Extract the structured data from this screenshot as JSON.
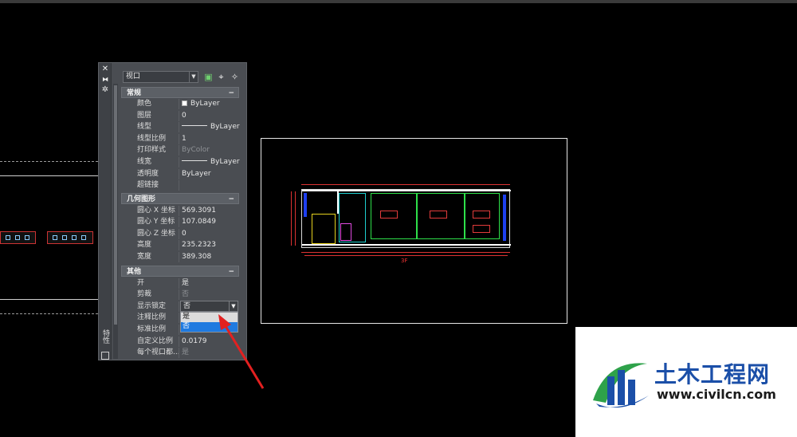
{
  "palette": {
    "vertical_title": "特性",
    "selector_value": "视口",
    "sections": {
      "general": {
        "title": "常规",
        "rows": [
          {
            "key": "颜色",
            "value": "ByLayer"
          },
          {
            "key": "图层",
            "value": "0"
          },
          {
            "key": "线型",
            "value": "ByLayer"
          },
          {
            "key": "线型比例",
            "value": "1"
          },
          {
            "key": "打印样式",
            "value": "ByColor"
          },
          {
            "key": "线宽",
            "value": "ByLayer"
          },
          {
            "key": "透明度",
            "value": "ByLayer"
          },
          {
            "key": "超链接",
            "value": ""
          }
        ]
      },
      "geometry": {
        "title": "几何图形",
        "rows": [
          {
            "key": "圆心 X 坐标",
            "value": "569.3091"
          },
          {
            "key": "圆心 Y 坐标",
            "value": "107.0849"
          },
          {
            "key": "圆心 Z 坐标",
            "value": "0"
          },
          {
            "key": "高度",
            "value": "235.2323"
          },
          {
            "key": "宽度",
            "value": "389.308"
          }
        ]
      },
      "misc": {
        "title": "其他",
        "rows": [
          {
            "key": "开",
            "value": "是"
          },
          {
            "key": "剪裁",
            "value": "否"
          },
          {
            "key": "显示锁定",
            "value": "否"
          },
          {
            "key": "注释比例",
            "value": ""
          },
          {
            "key": "标准比例",
            "value": ""
          },
          {
            "key": "自定义比例",
            "value": "0.0179"
          },
          {
            "key": "每个视口都...",
            "value": "是"
          }
        ]
      }
    },
    "dropdown_options": [
      "是",
      "否"
    ],
    "toggle_symbol": "−"
  },
  "drawing": {
    "plan_label": "3F"
  },
  "logo": {
    "brand": "土木工程网",
    "url": "www.civilcn.com"
  },
  "colors": {
    "palette_bg": "#4a4d52",
    "selected_option": "#1f7ae0",
    "arrow": "#e32020",
    "brand_blue": "#1b4fa8"
  }
}
